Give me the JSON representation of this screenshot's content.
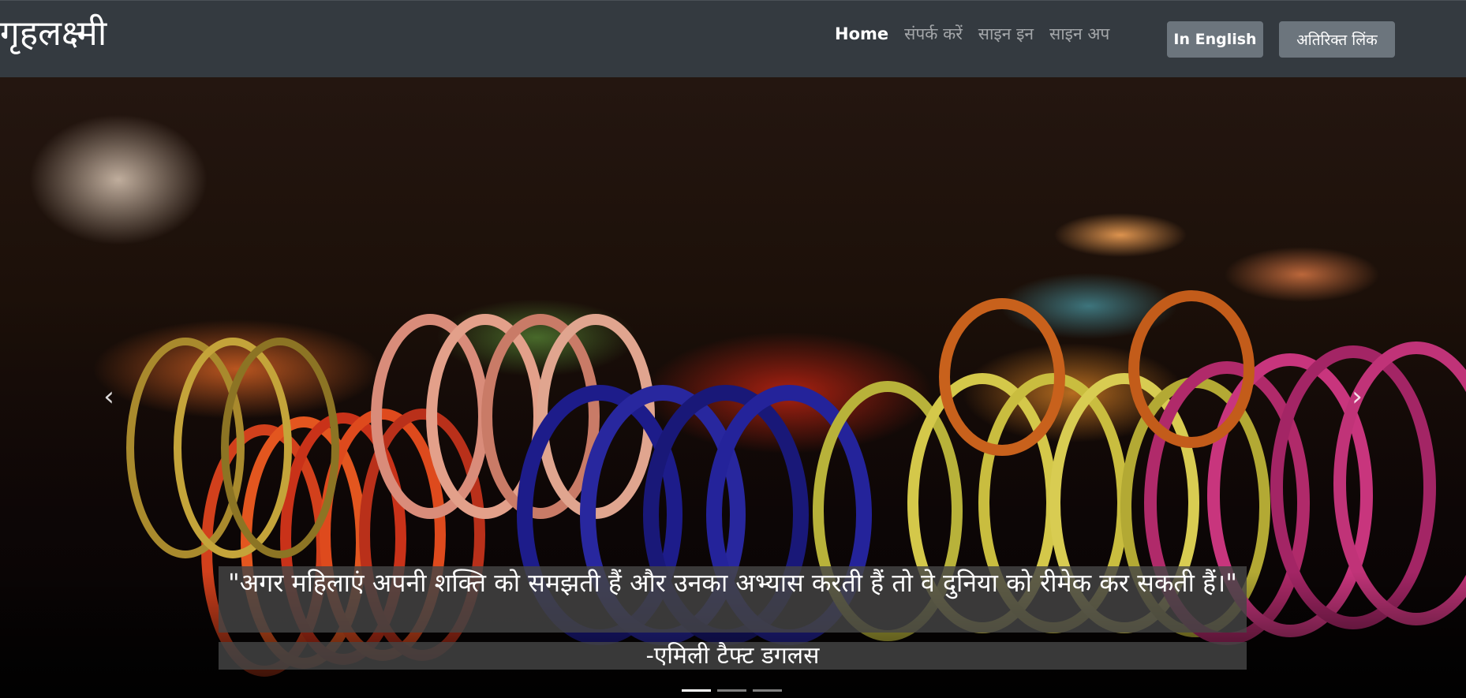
{
  "navbar": {
    "brand": "गृहलक्ष्मी",
    "links": [
      {
        "label": "Home",
        "active": true
      },
      {
        "label": "संपर्क करें",
        "active": false
      },
      {
        "label": "साइन इन",
        "active": false
      },
      {
        "label": "साइन अप",
        "active": false
      }
    ],
    "buttons": {
      "english": "In English",
      "extra_links": "अतिरिक्त लिंक"
    }
  },
  "carousel": {
    "prev_icon": "chevron-left-icon",
    "next_icon": "chevron-right-icon",
    "prev_glyph": "‹",
    "next_glyph": "›",
    "caption": {
      "quote": "\"अगर महिलाएं अपनी शक्ति को समझती हैं और उनका अभ्यास करती हैं तो वे दुनिया को रीमेक कर सकती हैं।\"",
      "author": "-एमिली टैफ्ट डगलस"
    },
    "slide_count": 3,
    "active_slide": 1
  },
  "colors": {
    "navbar_bg": "#343a40",
    "button_bg": "#6c757d",
    "caption_bg": "#464646"
  }
}
